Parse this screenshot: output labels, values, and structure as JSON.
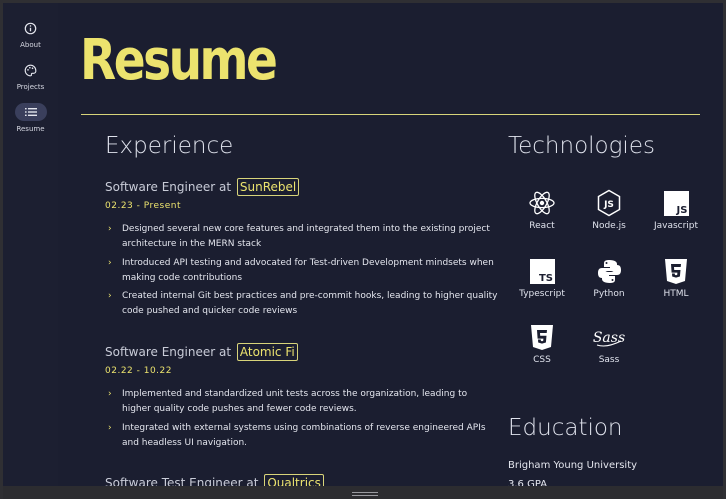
{
  "nav": [
    {
      "label": "About",
      "icon": "info-icon"
    },
    {
      "label": "Projects",
      "icon": "palette-icon"
    },
    {
      "label": "Resume",
      "icon": "list-icon",
      "active": true
    }
  ],
  "title": "Resume",
  "experience": {
    "heading": "Experience",
    "jobs": [
      {
        "role": "Software Engineer at",
        "company": "SunRebel",
        "dates": "02.23 - Present",
        "bullets": [
          "Designed several new core features and integrated them into the existing project architecture in the MERN stack",
          "Introduced API testing and advocated for Test-driven Development mindsets when making code contributions",
          "Created internal Git best practices and pre-commit hooks, leading to higher quality code pushed and quicker code reviews"
        ]
      },
      {
        "role": "Software Engineer at",
        "company": "Atomic Fi",
        "dates": "02.22 - 10.22",
        "bullets": [
          "Implemented and standardized unit tests across the organization, leading to higher quality code pushes and fewer code reviews.",
          "Integrated with external systems using combinations of reverse engineered APIs and headless UI navigation."
        ]
      },
      {
        "role": "Software Test Engineer at",
        "company": "Qualtrics"
      }
    ]
  },
  "technologies": {
    "heading": "Technologies",
    "items": [
      {
        "name": "React",
        "icon": "react-icon"
      },
      {
        "name": "Node.js",
        "icon": "nodejs-icon"
      },
      {
        "name": "Javascript",
        "icon": "javascript-icon"
      },
      {
        "name": "Typescript",
        "icon": "typescript-icon"
      },
      {
        "name": "Python",
        "icon": "python-icon"
      },
      {
        "name": "HTML",
        "icon": "html5-icon"
      },
      {
        "name": "CSS",
        "icon": "css3-icon"
      },
      {
        "name": "Sass",
        "icon": "sass-icon"
      }
    ]
  },
  "education": {
    "heading": "Education",
    "school": "Brigham Young University",
    "gpa": "3.6 GPA"
  },
  "colors": {
    "background": "#1b1e30",
    "accent": "#ece36e",
    "text": "#e4e6ee"
  }
}
